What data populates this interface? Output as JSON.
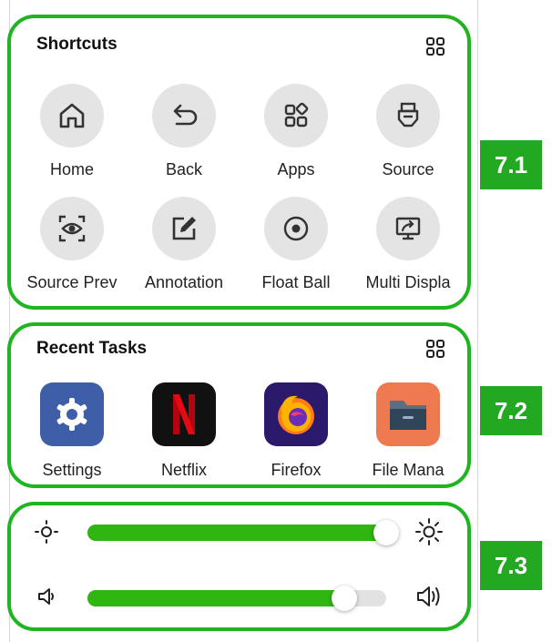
{
  "colors": {
    "accent": "#1fb521",
    "slider_fill": "#2fb611",
    "badge": "#23a822"
  },
  "shortcuts": {
    "title": "Shortcuts",
    "items": [
      {
        "label": "Home",
        "icon": "home-icon"
      },
      {
        "label": "Back",
        "icon": "back-arrow-icon"
      },
      {
        "label": "Apps",
        "icon": "apps-icon"
      },
      {
        "label": "Source",
        "icon": "source-plug-icon"
      },
      {
        "label": "Source Prev",
        "icon": "source-preview-eye-icon"
      },
      {
        "label": "Annotation",
        "icon": "annotation-pen-icon"
      },
      {
        "label": "Float Ball",
        "icon": "float-ball-icon"
      },
      {
        "label": "Multi Displa",
        "icon": "multi-display-icon"
      }
    ]
  },
  "recent_tasks": {
    "title": "Recent Tasks",
    "apps": [
      {
        "label": "Settings",
        "icon": "settings-gear-icon"
      },
      {
        "label": "Netflix",
        "icon": "netflix-icon"
      },
      {
        "label": "Firefox",
        "icon": "firefox-icon"
      },
      {
        "label": "File Mana",
        "icon": "file-manager-icon"
      }
    ]
  },
  "controls": {
    "brightness": {
      "level": 1.0,
      "icon_low": "brightness-low-icon",
      "icon_high": "brightness-high-icon"
    },
    "volume": {
      "level": 0.86,
      "icon_low": "volume-low-icon",
      "icon_high": "volume-high-icon"
    }
  },
  "badges": [
    "7.1",
    "7.2",
    "7.3"
  ]
}
